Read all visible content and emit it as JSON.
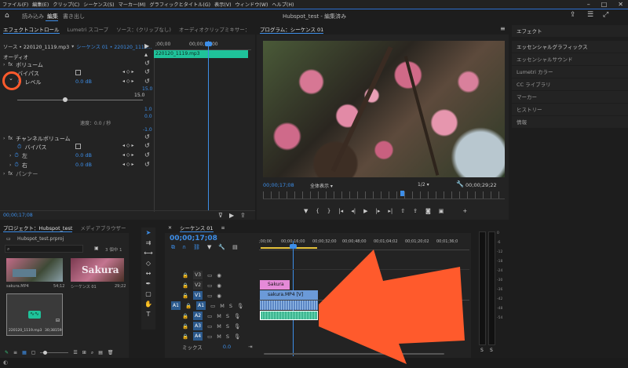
{
  "menubar": {
    "items": [
      "ファイル(F)",
      "編集(E)",
      "クリップ(C)",
      "シーケンス(S)",
      "マーカー(M)",
      "グラフィックとタイトル(G)",
      "表示(V)",
      "ウィンドウ(W)",
      "ヘルプ(H)"
    ]
  },
  "workspace": {
    "tabs": [
      "読み込み",
      "編集",
      "書き出し"
    ],
    "active": "編集",
    "title": "Hubspot_test - 編集済み"
  },
  "effect_controls": {
    "tabs": [
      "エフェクトコントロール",
      "Lumetri スコープ",
      "ソース：(クリップなし)",
      "オーディオクリップミキサー："
    ],
    "source": "ソース • 220120_1119.mp3",
    "seq": "シーケンス 01 • 220120_1119...",
    "ruler_start": ";00;00",
    "ruler_mid": "00;00;16;00",
    "clip_name": "220120_1119.mp3",
    "section": "オーディオ",
    "volume": "ボリューム",
    "bypass": "バイパス",
    "level": "レベル",
    "level_value": "0.0 dB",
    "scale": [
      "15.0",
      "15.0",
      "",
      "1.0",
      "0.0",
      "-1.0"
    ],
    "speed": "速度：0.0 / 秒",
    "channel_volume": "チャンネルボリューム",
    "bypass2": "バイパス",
    "left": "左",
    "left_value": "0.0 dB",
    "right": "右",
    "right_value": "0.0 dB",
    "panner": "パンナー",
    "timecode": "00;00;17;08"
  },
  "program": {
    "tab": "プログラム：シーケンス 01",
    "timecode": "00;00;17;08",
    "fit": "全体表示",
    "ratio": "1/2",
    "duration": "00;00;29;22"
  },
  "right_panel": {
    "tabs": [
      "エフェクト"
    ],
    "items": [
      "エッセンシャルグラフィックス",
      "エッセンシャルサウンド",
      "Lumetri カラー",
      "CC ライブラリ",
      "マーカー",
      "ヒストリー",
      "情報"
    ]
  },
  "project": {
    "tabs": [
      "プロジェクト：Hubspot_test",
      "メディアブラウザー"
    ],
    "file": "Hubspot_test.prproj",
    "count": "3 個中 1",
    "items": [
      {
        "name": "sakura.MP4",
        "duration": "54;12"
      },
      {
        "name": "シーケンス 01",
        "duration": "29;22"
      },
      {
        "name": "220120_1119.mp3",
        "duration": "30;38159"
      }
    ],
    "thumb_text": "Sakura"
  },
  "timeline": {
    "tab": "シーケンス 01",
    "timecode": "00;00;17;08",
    "ruler": [
      ";00;00",
      "00;00;16;00",
      "00;00;32;00",
      "00;00;48;00",
      "00;01;04;02",
      "00;01;20;02",
      "00;01;36;0"
    ],
    "video_tracks": [
      "V3",
      "V2",
      "V1"
    ],
    "audio_tracks": [
      "A1",
      "A2",
      "A3",
      "A4"
    ],
    "source_patch": "A1",
    "mix": "ミックス",
    "mix_value": "0.0",
    "clips": {
      "title": "Sakura",
      "video": "sakura.MP4 [V]"
    }
  },
  "meter": {
    "scale": [
      "0",
      "-6",
      "-12",
      "-18",
      "-24",
      "-30",
      "-36",
      "-42",
      "-48",
      "-54"
    ],
    "solo": [
      "S",
      "S"
    ]
  },
  "colors": {
    "accent": "#3d8ee8",
    "arrow": "#ff5a2c",
    "highlight": "#ff5a2c"
  }
}
